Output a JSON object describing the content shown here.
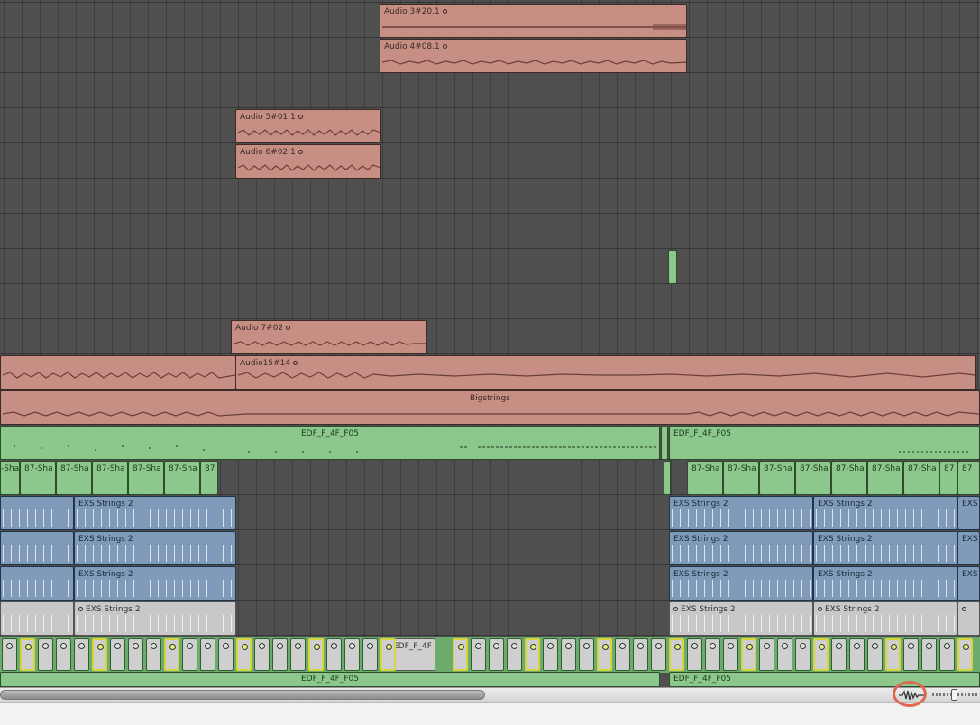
{
  "window": {
    "title": ""
  },
  "colors": {
    "audio_region": "#c78e84",
    "midi_green": "#8cc88c",
    "midi_blue": "#7f9bb9",
    "midi_grey": "#c8c8c8",
    "highlight": "#e06850",
    "selected_step": "#d8d43b"
  },
  "regions": {
    "audio_3": "Audio 3#20.1",
    "audio_4": "Audio 4#08.1",
    "audio_5": "Audio 5#01.1",
    "audio_6": "Audio 6#02.1",
    "audio_7": "Audio 7#02",
    "audio_15": "Audio15#14",
    "bigstrings": "Bigstrings",
    "edf_main": "EDF_F_4F_F05",
    "edf_mid": "EDF_F_4F",
    "edf_bottom": "EDF_F_4F_F05",
    "sha_left": "-Sha",
    "sha": "87-Sha",
    "sha_short": "87",
    "exs": "EXS Strings 2",
    "exs_prefix": "EXS"
  },
  "scrollbar": {
    "position_fraction": 0.0
  },
  "zoom": {
    "icon": "waveform-zoom-icon",
    "level_fraction": 0.44
  }
}
